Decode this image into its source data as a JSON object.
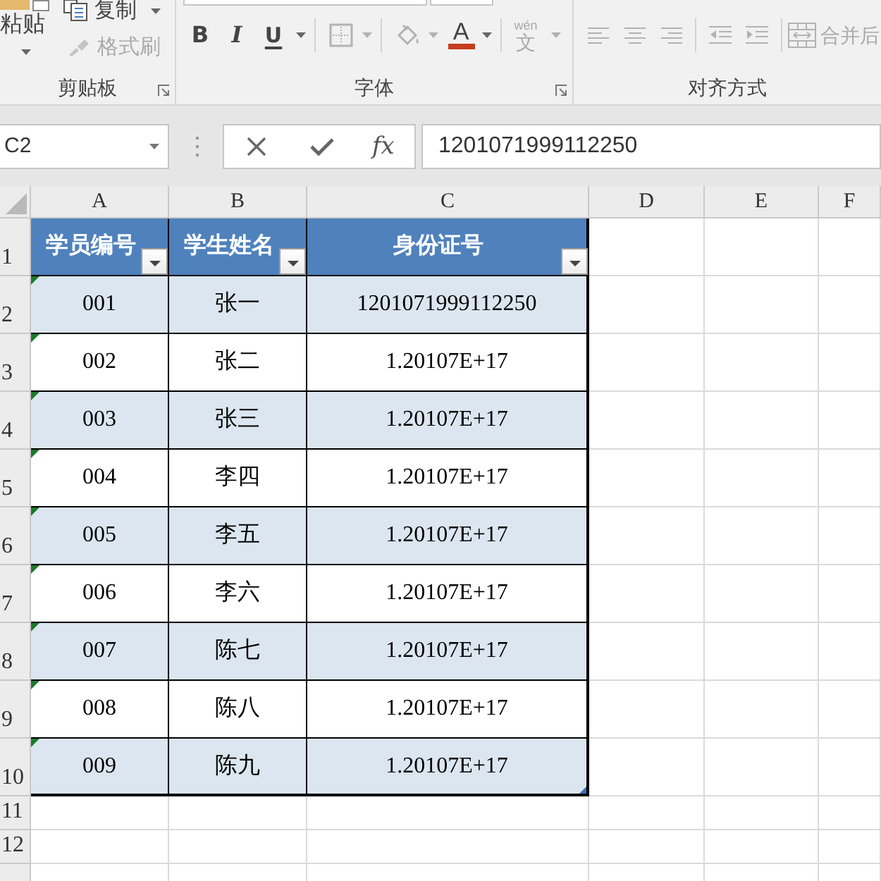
{
  "ribbon": {
    "clipboard": {
      "label": "剪贴板",
      "paste": {
        "label": "粘贴",
        "disabled": false
      },
      "copy": {
        "label": "复制",
        "disabled": false
      },
      "format_painter": {
        "label": "格式刷",
        "disabled": true
      }
    },
    "font": {
      "label": "字体",
      "tool_groups": [
        [
          {
            "kind": "bold",
            "text": "B",
            "disabled": false,
            "dropdown": false
          },
          {
            "kind": "italic",
            "text": "I",
            "disabled": false,
            "dropdown": false
          },
          {
            "kind": "underline",
            "text": "U",
            "disabled": false,
            "dropdown": true
          }
        ],
        [
          {
            "kind": "borders",
            "disabled": true,
            "dropdown": true
          }
        ],
        [
          {
            "kind": "fill",
            "disabled": true,
            "dropdown": true
          },
          {
            "kind": "font_color",
            "text": "A",
            "color": "#c53d1d",
            "disabled": false,
            "dropdown": true
          }
        ],
        [
          {
            "kind": "phonetic",
            "ruby": "wén",
            "text": "文",
            "disabled": true,
            "dropdown": true
          }
        ]
      ]
    },
    "alignment": {
      "label": "对齐方式",
      "tool_groups": [
        [
          {
            "kind": "align_left",
            "disabled": true
          },
          {
            "kind": "align_center",
            "disabled": true
          },
          {
            "kind": "align_right",
            "disabled": true
          }
        ],
        [
          {
            "kind": "indent_decrease",
            "disabled": true
          },
          {
            "kind": "indent_increase",
            "disabled": true
          }
        ],
        [
          {
            "kind": "merge",
            "text": "合并后",
            "disabled": true
          }
        ]
      ]
    }
  },
  "formula_bar": {
    "name_box": "C2",
    "function_label": "fx",
    "formula": "1201071999112250"
  },
  "sheet": {
    "columns": [
      "A",
      "B",
      "C",
      "D",
      "E",
      "F"
    ],
    "row_numbers": [
      "1",
      "2",
      "3",
      "4",
      "5",
      "6",
      "7",
      "8",
      "9",
      "10",
      "11",
      "12"
    ],
    "table": {
      "banded_rows": true,
      "headers": [
        {
          "label": "学员编号",
          "filter": true
        },
        {
          "label": "学生姓名",
          "filter": true
        },
        {
          "label": "身份证号",
          "filter": true
        }
      ],
      "rows": [
        {
          "cells": [
            "001",
            "张一",
            "1201071999112250"
          ],
          "error_flag": true
        },
        {
          "cells": [
            "002",
            "张二",
            "1.20107E+17"
          ],
          "error_flag": true
        },
        {
          "cells": [
            "003",
            "张三",
            "1.20107E+17"
          ],
          "error_flag": true
        },
        {
          "cells": [
            "004",
            "李四",
            "1.20107E+17"
          ],
          "error_flag": true
        },
        {
          "cells": [
            "005",
            "李五",
            "1.20107E+17"
          ],
          "error_flag": true
        },
        {
          "cells": [
            "006",
            "李六",
            "1.20107E+17"
          ],
          "error_flag": true
        },
        {
          "cells": [
            "007",
            "陈七",
            "1.20107E+17"
          ],
          "error_flag": true
        },
        {
          "cells": [
            "008",
            "陈八",
            "1.20107E+17"
          ],
          "error_flag": true
        },
        {
          "cells": [
            "009",
            "陈九",
            "1.20107E+17"
          ],
          "error_flag": true
        }
      ]
    }
  }
}
